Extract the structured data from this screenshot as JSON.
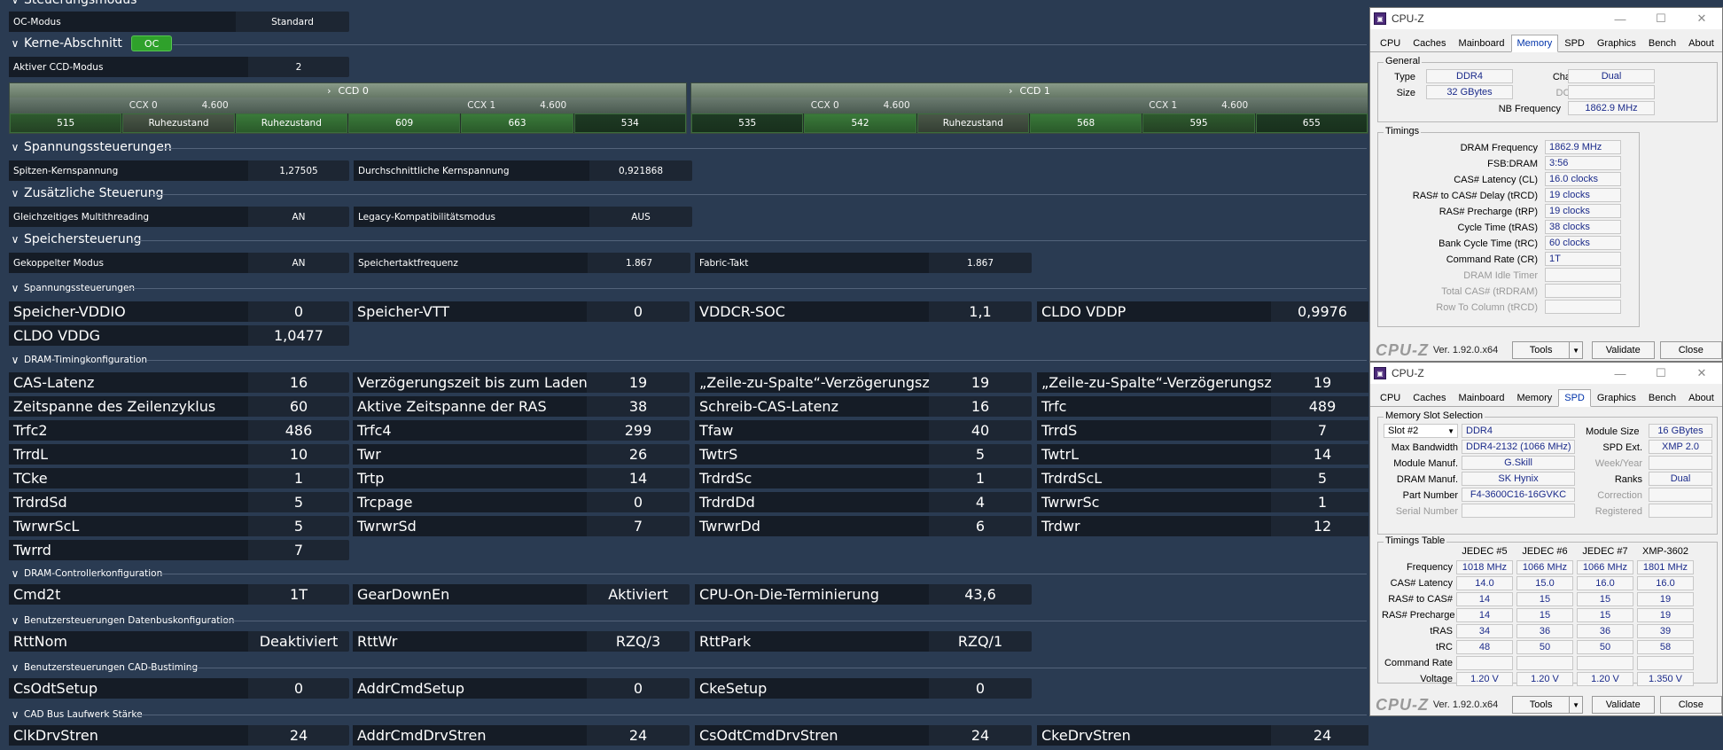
{
  "sections": {
    "steuerungsmodus": "Steuerungsmodus",
    "kerne": "Kerne-Abschnitt",
    "kerne_badge": "OC",
    "spannung": "Spannungssteuerungen",
    "zusatz": "Zusätzliche Steuerung",
    "speicher": "Speichersteuerung",
    "spannung2": "Spannungssteuerungen",
    "dram_timing": "DRAM-Timingkonfiguration",
    "dram_ctrl": "DRAM-Controllerkonfiguration",
    "benutzer_daten": "Benutzersteuerungen Datenbuskonfiguration",
    "benutzer_cad": "Benutzersteuerungen CAD-Bustiming",
    "cad_bus": "CAD Bus Laufwerk Stärke"
  },
  "oc_modus": {
    "label": "OC-Modus",
    "value": "Standard"
  },
  "aktiver_ccd": {
    "label": "Aktiver CCD-Modus",
    "value": "2"
  },
  "ccd": [
    {
      "name": "CCD 0",
      "ccx": [
        {
          "name": "CCX 0",
          "freq": "4.600",
          "cores": [
            "515",
            "Ruhezustand",
            "Ruhezustand"
          ]
        },
        {
          "name": "CCX 1",
          "freq": "4.600",
          "cores": [
            "609",
            "663",
            "534"
          ]
        }
      ]
    },
    {
      "name": "CCD 1",
      "ccx": [
        {
          "name": "CCX 0",
          "freq": "4.600",
          "cores": [
            "535",
            "542",
            "Ruhezustand"
          ]
        },
        {
          "name": "CCX 1",
          "freq": "4.600",
          "cores": [
            "568",
            "595",
            "655"
          ]
        }
      ]
    }
  ],
  "spannung_row": [
    {
      "label": "Spitzen-Kernspannung",
      "value": "1,27505"
    },
    {
      "label": "Durchschnittliche Kernspannung",
      "value": "0,921868"
    }
  ],
  "zusatz_row": [
    {
      "label": "Gleichzeitiges Multithreading",
      "value": "AN"
    },
    {
      "label": "Legacy-Kompatibilitätsmodus",
      "value": "AUS"
    }
  ],
  "speicher_row": [
    {
      "label": "Gekoppelter Modus",
      "value": "AN"
    },
    {
      "label": "Speichertaktfrequenz",
      "value": "1.867"
    },
    {
      "label": "Fabric-Takt",
      "value": "1.867"
    }
  ],
  "spannung2_rows": [
    [
      {
        "label": "Speicher-VDDIO",
        "value": "0"
      },
      {
        "label": "Speicher-VTT",
        "value": "0"
      },
      {
        "label": "VDDCR-SOC",
        "value": "1,1"
      },
      {
        "label": "CLDO VDDP",
        "value": "0,9976"
      }
    ],
    [
      {
        "label": "CLDO VDDG",
        "value": "1,0477"
      }
    ]
  ],
  "timing_rows": [
    [
      {
        "label": "CAS-Latenz",
        "value": "16"
      },
      {
        "label": "Verzögerungszeit bis zum Laden der Zeile",
        "value": "19"
      },
      {
        "label": "„Zeile-zu-Spalte“-Verzögerungszeit für Lesevorgang",
        "value": "19"
      },
      {
        "label": "„Zeile-zu-Spalte“-Verzögerungszeit für Schreibvorg...",
        "value": "19"
      }
    ],
    [
      {
        "label": "Zeitspanne des Zeilenzyklus",
        "value": "60"
      },
      {
        "label": "Aktive Zeitspanne der RAS",
        "value": "38"
      },
      {
        "label": "Schreib-CAS-Latenz",
        "value": "16"
      },
      {
        "label": "Trfc",
        "value": "489"
      }
    ],
    [
      {
        "label": "Trfc2",
        "value": "486"
      },
      {
        "label": "Trfc4",
        "value": "299"
      },
      {
        "label": "Tfaw",
        "value": "40"
      },
      {
        "label": "TrrdS",
        "value": "7"
      }
    ],
    [
      {
        "label": "TrrdL",
        "value": "10"
      },
      {
        "label": "Twr",
        "value": "26"
      },
      {
        "label": "TwtrS",
        "value": "5"
      },
      {
        "label": "TwtrL",
        "value": "14"
      }
    ],
    [
      {
        "label": "TCke",
        "value": "1"
      },
      {
        "label": "Trtp",
        "value": "14"
      },
      {
        "label": "TrdrdSc",
        "value": "1"
      },
      {
        "label": "TrdrdScL",
        "value": "5"
      }
    ],
    [
      {
        "label": "TrdrdSd",
        "value": "5"
      },
      {
        "label": "Trcpage",
        "value": "0"
      },
      {
        "label": "TrdrdDd",
        "value": "4"
      },
      {
        "label": "TwrwrSc",
        "value": "1"
      }
    ],
    [
      {
        "label": "TwrwrScL",
        "value": "5"
      },
      {
        "label": "TwrwrSd",
        "value": "7"
      },
      {
        "label": "TwrwrDd",
        "value": "6"
      },
      {
        "label": "Trdwr",
        "value": "12"
      }
    ],
    [
      {
        "label": "Twrrd",
        "value": "7"
      }
    ]
  ],
  "ctrl_row": [
    {
      "label": "Cmd2t",
      "value": "1T"
    },
    {
      "label": "GearDownEn",
      "value": "Aktiviert"
    },
    {
      "label": "CPU-On-Die-Terminierung",
      "value": "43,6"
    }
  ],
  "daten_row": [
    {
      "label": "RttNom",
      "value": "Deaktiviert"
    },
    {
      "label": "RttWr",
      "value": "RZQ/3"
    },
    {
      "label": "RttPark",
      "value": "RZQ/1"
    }
  ],
  "cad_row": [
    {
      "label": "CsOdtSetup",
      "value": "0"
    },
    {
      "label": "AddrCmdSetup",
      "value": "0"
    },
    {
      "label": "CkeSetup",
      "value": "0"
    }
  ],
  "drv_row": [
    {
      "label": "ClkDrvStren",
      "value": "24"
    },
    {
      "label": "AddrCmdDrvStren",
      "value": "24"
    },
    {
      "label": "CsOdtCmdDrvStren",
      "value": "24"
    },
    {
      "label": "CkeDrvStren",
      "value": "24"
    }
  ],
  "cpuz": {
    "title": "CPU-Z",
    "tabs": [
      "CPU",
      "Caches",
      "Mainboard",
      "Memory",
      "SPD",
      "Graphics",
      "Bench",
      "About"
    ],
    "version": "Ver. 1.92.0.x64",
    "tools": "Tools",
    "validate": "Validate",
    "close": "Close",
    "logo": "CPU-Z",
    "memory": {
      "general_title": "General",
      "type_label": "Type",
      "type": "DDR4",
      "size_label": "Size",
      "size": "32 GBytes",
      "channel_label": "Channel #",
      "channel": "Dual",
      "dcmode_label": "DC Mode",
      "dcmode": "",
      "nbfreq_label": "NB Frequency",
      "nbfreq": "1862.9 MHz",
      "timings_title": "Timings",
      "timings": [
        {
          "label": "DRAM Frequency",
          "value": "1862.9 MHz",
          "dim": false
        },
        {
          "label": "FSB:DRAM",
          "value": "3:56",
          "dim": false
        },
        {
          "label": "CAS# Latency (CL)",
          "value": "16.0 clocks",
          "dim": false
        },
        {
          "label": "RAS# to CAS# Delay (tRCD)",
          "value": "19 clocks",
          "dim": false
        },
        {
          "label": "RAS# Precharge (tRP)",
          "value": "19 clocks",
          "dim": false
        },
        {
          "label": "Cycle Time (tRAS)",
          "value": "38 clocks",
          "dim": false
        },
        {
          "label": "Bank Cycle Time (tRC)",
          "value": "60 clocks",
          "dim": false
        },
        {
          "label": "Command Rate (CR)",
          "value": "1T",
          "dim": false
        },
        {
          "label": "DRAM Idle Timer",
          "value": "",
          "dim": true
        },
        {
          "label": "Total CAS# (tRDRAM)",
          "value": "",
          "dim": true
        },
        {
          "label": "Row To Column (tRCD)",
          "value": "",
          "dim": true
        }
      ]
    },
    "spd": {
      "slot_title": "Memory Slot Selection",
      "slot": "Slot #2",
      "type": "DDR4",
      "module_size_label": "Module Size",
      "module_size": "16 GBytes",
      "max_bw_label": "Max Bandwidth",
      "max_bw": "DDR4-2132 (1066 MHz)",
      "spd_ext_label": "SPD Ext.",
      "spd_ext": "XMP 2.0",
      "manuf_label": "Module Manuf.",
      "manuf": "G.Skill",
      "week_label": "Week/Year",
      "week": "",
      "dram_manuf_label": "DRAM Manuf.",
      "dram_manuf": "SK Hynix",
      "ranks_label": "Ranks",
      "ranks": "Dual",
      "part_label": "Part Number",
      "part": "F4-3600C16-16GVKC",
      "correction_label": "Correction",
      "correction": "",
      "serial_label": "Serial Number",
      "serial": "",
      "registered_label": "Registered",
      "registered": "",
      "table_title": "Timings Table",
      "columns": [
        "JEDEC #5",
        "JEDEC #6",
        "JEDEC #7",
        "XMP-3602"
      ],
      "rows": [
        {
          "label": "Frequency",
          "values": [
            "1018 MHz",
            "1066 MHz",
            "1066 MHz",
            "1801 MHz"
          ]
        },
        {
          "label": "CAS# Latency",
          "values": [
            "14.0",
            "15.0",
            "16.0",
            "16.0"
          ]
        },
        {
          "label": "RAS# to CAS#",
          "values": [
            "14",
            "15",
            "15",
            "19"
          ]
        },
        {
          "label": "RAS# Precharge",
          "values": [
            "14",
            "15",
            "15",
            "19"
          ]
        },
        {
          "label": "tRAS",
          "values": [
            "34",
            "36",
            "36",
            "39"
          ]
        },
        {
          "label": "tRC",
          "values": [
            "48",
            "50",
            "50",
            "58"
          ]
        },
        {
          "label": "Command Rate",
          "values": [
            "",
            "",
            "",
            ""
          ]
        },
        {
          "label": "Voltage",
          "values": [
            "1.20 V",
            "1.20 V",
            "1.20 V",
            "1.350 V"
          ]
        }
      ]
    }
  }
}
